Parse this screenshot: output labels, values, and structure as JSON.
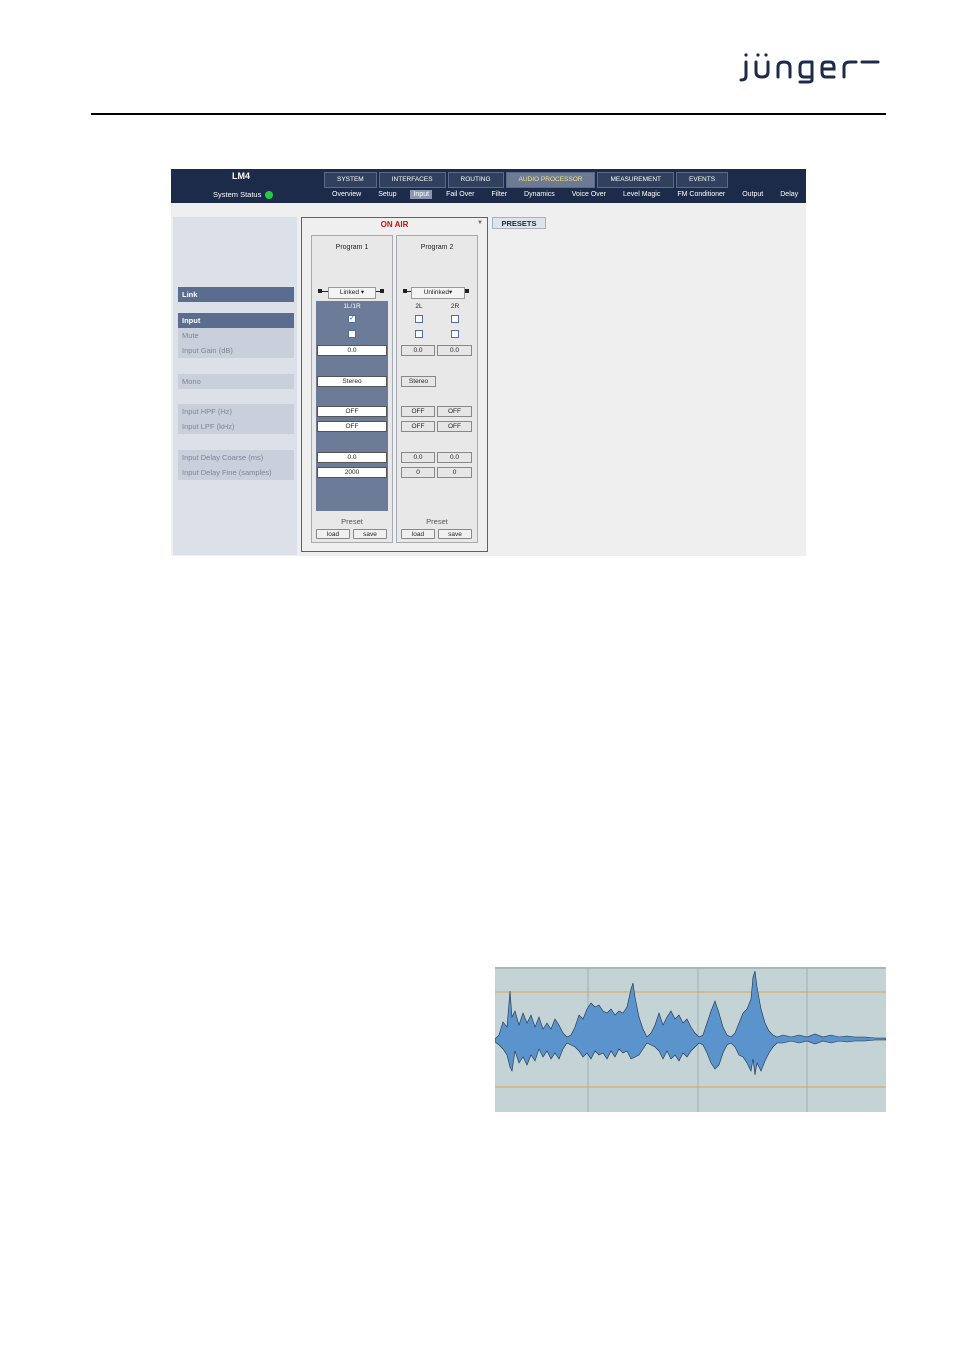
{
  "document": {
    "logo_text": "jünger"
  },
  "app": {
    "device_name": "LM4",
    "system_status_label": "System Status",
    "system_status_color": "#22cc44",
    "main_tabs": [
      {
        "label": "SYSTEM",
        "active": false
      },
      {
        "label": "INTERFACES",
        "active": false
      },
      {
        "label": "ROUTING",
        "active": false
      },
      {
        "label": "AUDIO PROCESSOR",
        "active": true
      },
      {
        "label": "MEASUREMENT",
        "active": false
      },
      {
        "label": "EVENTS",
        "active": false
      }
    ],
    "sub_tabs": [
      {
        "label": "Overview",
        "active": false
      },
      {
        "label": "Setup",
        "active": false
      },
      {
        "label": "Input",
        "active": true
      },
      {
        "label": "Fail Over",
        "active": false
      },
      {
        "label": "Filter",
        "active": false
      },
      {
        "label": "Dynamics",
        "active": false
      },
      {
        "label": "Voice Over",
        "active": false
      },
      {
        "label": "Level Magic",
        "active": false
      },
      {
        "label": "FM Conditioner",
        "active": false
      },
      {
        "label": "Output",
        "active": false
      },
      {
        "label": "Delay",
        "active": false
      }
    ],
    "params": {
      "link": "Link",
      "input": "Input",
      "mute": "Mute",
      "input_gain": "Input Gain (dB)",
      "mono": "Mono",
      "input_hpf": "Input HPF (Hz)",
      "input_lpf": "Input LPF (kHz)",
      "delay_coarse": "Input Delay Coarse (ms)",
      "delay_fine": "Input Delay Fine (samples)"
    },
    "on_air_label": "ON AIR",
    "presets_label": "PRESETS",
    "program1": {
      "title": "Program 1",
      "link_mode": "Linked",
      "channel": "1L/1R",
      "input_checked": true,
      "mute_checked": false,
      "gain": "0.0",
      "mono": "Stereo",
      "hpf": "OFF",
      "lpf": "OFF",
      "delay_coarse": "0.0",
      "delay_fine": "2000",
      "preset_label": "Preset",
      "load": "load",
      "save": "save"
    },
    "program2": {
      "title": "Program 2",
      "link_mode": "Unlinked",
      "channels": [
        "2L",
        "2R"
      ],
      "gain": [
        "0.0",
        "0.0"
      ],
      "mono": "Stereo",
      "hpf": [
        "OFF",
        "OFF"
      ],
      "lpf": [
        "OFF",
        "OFF"
      ],
      "delay_coarse": [
        "0.0",
        "0.0"
      ],
      "delay_fine": [
        "0",
        "0"
      ],
      "preset_label": "Preset",
      "load": "load",
      "save": "save"
    }
  },
  "waveform": {
    "background": "#c4d4d6",
    "wave_color": "#5b93cc",
    "guide_color": "#e0a050"
  }
}
